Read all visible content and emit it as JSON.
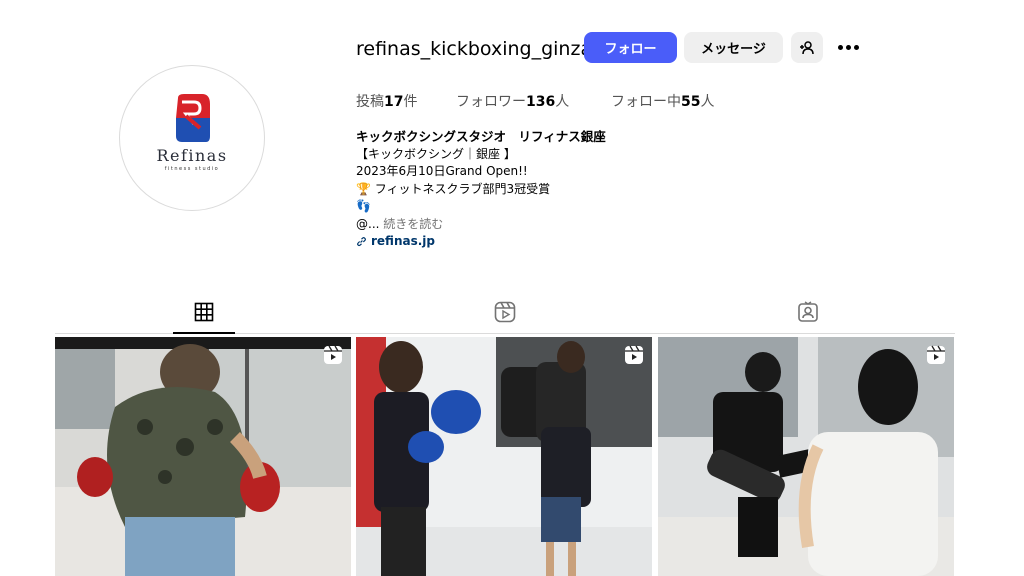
{
  "profile": {
    "username": "refinas_kickboxing_ginza",
    "logo_text": "Refinas",
    "logo_subtext": "fitness studio",
    "buttons": {
      "follow": "フォロー",
      "message": "メッセージ"
    },
    "icons": {
      "add_person": "add-person-icon",
      "more": "more-options-icon"
    },
    "stats": {
      "posts_label": "投稿",
      "posts_value": "17",
      "posts_unit": "件",
      "followers_label": "フォロワー",
      "followers_value": "136",
      "followers_unit": "人",
      "following_label": "フォロー中",
      "following_value": "55",
      "following_unit": "人"
    },
    "bio": {
      "name": "キックボクシングスタジオ　リフィナス銀座",
      "line1": "【キックボクシング｜銀座 】",
      "line2": "2023年6月10日Grand Open!!",
      "line3": "🏆 フィットネスクラブ部門3冠受賞",
      "line4": "👣",
      "line5_prefix": "@... ",
      "line5_more": "続きを読む",
      "link": "refinas.jp"
    },
    "colors": {
      "follow_button": "#4a5df9",
      "secondary_button": "#efefef",
      "link": "#00376b"
    }
  },
  "tabs": [
    {
      "name": "posts",
      "icon": "grid-icon",
      "active": true
    },
    {
      "name": "reels",
      "icon": "reels-icon",
      "active": false
    },
    {
      "name": "tagged",
      "icon": "tagged-icon",
      "active": false
    }
  ],
  "grid": [
    {
      "type": "reel",
      "badge_icon": "reel-badge-icon"
    },
    {
      "type": "reel",
      "badge_icon": "reel-badge-icon"
    },
    {
      "type": "reel",
      "badge_icon": "reel-badge-icon"
    }
  ]
}
